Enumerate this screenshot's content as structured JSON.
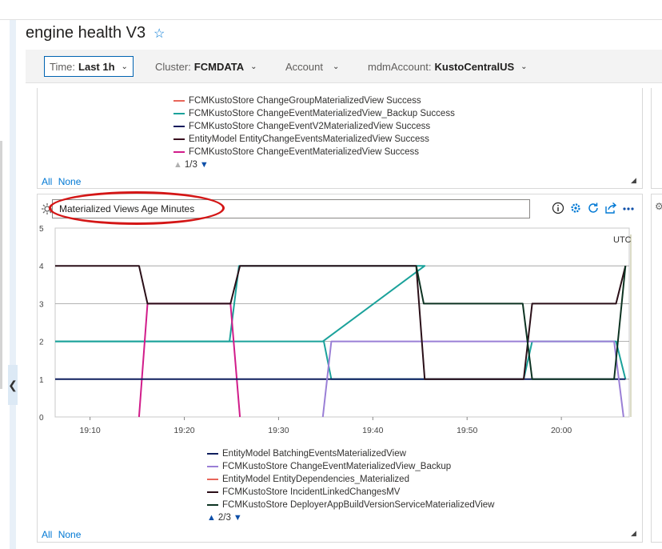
{
  "page": {
    "title": "engine health V3",
    "favorite_icon": "star-outline-icon"
  },
  "filters": [
    {
      "key": "Time:",
      "value": "Last 1h"
    },
    {
      "key": "Cluster:",
      "value": "FCMDATA"
    },
    {
      "key": "Account",
      "value": ""
    },
    {
      "key": "mdmAccount:",
      "value": "KustoCentralUS"
    }
  ],
  "top_tile": {
    "legend": [
      {
        "name": "FCMKustoStore ChangeGroupMaterializedView Success",
        "color": "#e8665a"
      },
      {
        "name": "FCMKustoStore ChangeEventMaterializedView_Backup Success",
        "color": "#1ba29b"
      },
      {
        "name": "FCMKustoStore ChangeEventV2MaterializedView Success",
        "color": "#101a5c"
      },
      {
        "name": "EntityModel EntityChangeEventsMaterializedView Success",
        "color": "#3a0f1f"
      },
      {
        "name": "FCMKustoStore ChangeEventMaterializedView Success",
        "color": "#d11c8a"
      }
    ],
    "pager": "1/3",
    "all_label": "All",
    "none_label": "None"
  },
  "bottom_tile": {
    "title": "Materialized Views Age Minutes",
    "icons": [
      "info-icon",
      "settings-cog-icon",
      "refresh-icon",
      "share-icon",
      "more-icon"
    ],
    "legend": [
      {
        "name": "EntityModel BatchingEventsMaterializedView",
        "color": "#0f1e5e"
      },
      {
        "name": "FCMKustoStore ChangeEventMaterializedView_Backup",
        "color": "#9a7fd6"
      },
      {
        "name": "EntityModel EntityDependencies_Materialized",
        "color": "#e8665a"
      },
      {
        "name": "FCMKustoStore IncidentLinkedChangesMV",
        "color": "#2a0f18"
      },
      {
        "name": "FCMKustoStore DeployerAppBuildVersionServiceMaterializedView",
        "color": "#0d3322"
      }
    ],
    "pager": "2/3",
    "all_label": "All",
    "none_label": "None"
  },
  "chart_data": {
    "type": "line",
    "timezone_label": "UTC",
    "ylim": [
      0,
      5
    ],
    "y_ticks": [
      "0",
      "1",
      "2",
      "3",
      "4",
      "5"
    ],
    "x_ticks": [
      {
        "label": "19:10",
        "t": 10
      },
      {
        "label": "19:20",
        "t": 20
      },
      {
        "label": "19:30",
        "t": 30
      },
      {
        "label": "19:40",
        "t": 40
      },
      {
        "label": "19:50",
        "t": 50
      },
      {
        "label": "20:00",
        "t": 60
      }
    ],
    "xlim": [
      6.3,
      67.2
    ],
    "grid": true,
    "series": [
      {
        "color": "#1ba29b",
        "points": [
          [
            6.3,
            2
          ],
          [
            24.8,
            2
          ],
          [
            25.8,
            4
          ],
          [
            44.6,
            4
          ],
          [
            45.5,
            4
          ],
          [
            34.7,
            2
          ]
        ]
      },
      {
        "color": "#1ba29b",
        "points": [
          [
            6.3,
            2
          ],
          [
            24.8,
            2
          ],
          [
            25.8,
            2
          ],
          [
            34.8,
            2
          ],
          [
            35.6,
            1
          ],
          [
            56.0,
            1
          ],
          [
            56.9,
            2
          ],
          [
            65.8,
            2
          ],
          [
            66.8,
            1
          ]
        ]
      },
      {
        "color": "#d11c8a",
        "points": [
          [
            15.2,
            0
          ],
          [
            16.1,
            3
          ],
          [
            24.9,
            3
          ],
          [
            25.9,
            0
          ]
        ]
      },
      {
        "color": "#0f1e5e",
        "points": [
          [
            6.3,
            1
          ],
          [
            66.8,
            1
          ]
        ]
      },
      {
        "color": "#9a7fd6",
        "points": [
          [
            34.7,
            0
          ],
          [
            35.6,
            2
          ],
          [
            65.6,
            2
          ],
          [
            66.6,
            0
          ]
        ]
      },
      {
        "color": "#2a0f18",
        "points": [
          [
            6.3,
            4
          ],
          [
            15.2,
            4
          ],
          [
            16.1,
            3
          ],
          [
            24.9,
            3
          ],
          [
            25.9,
            4
          ],
          [
            44.6,
            4
          ],
          [
            45.5,
            1
          ],
          [
            56.0,
            1
          ],
          [
            56.9,
            3
          ],
          [
            65.8,
            3
          ],
          [
            66.8,
            4
          ]
        ]
      },
      {
        "color": "#0d3322",
        "points": [
          [
            44.6,
            4
          ],
          [
            45.4,
            3
          ],
          [
            55.9,
            3
          ],
          [
            56.9,
            1
          ],
          [
            65.6,
            1
          ],
          [
            66.8,
            4
          ]
        ]
      }
    ]
  }
}
